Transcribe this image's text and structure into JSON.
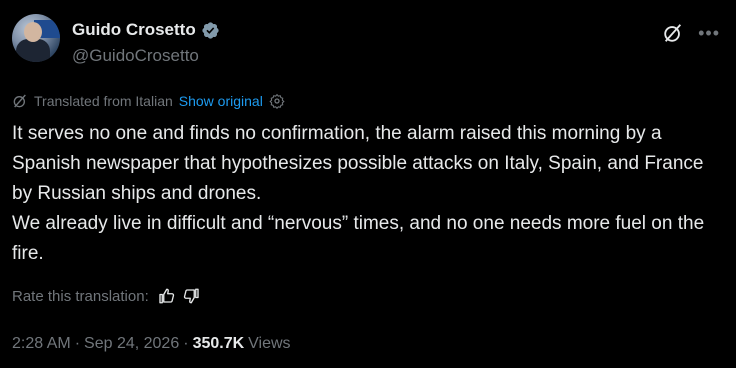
{
  "author": {
    "name": "Guido Crosetto",
    "handle": "@GuidoCrosetto"
  },
  "translation": {
    "label": "Translated from Italian",
    "show_original": "Show original"
  },
  "tweet": {
    "paragraph1": "It serves no one and finds no confirmation, the alarm raised this morning by a Spanish newspaper that hypothesizes possible attacks on Italy, Spain, and France by Russian ships and drones.",
    "paragraph2": "We already live in difficult and “nervous” times, and no one needs more fuel on the fire."
  },
  "rate": {
    "label": "Rate this translation:"
  },
  "meta": {
    "time": "2:28 AM",
    "sep1": "·",
    "date": "Sep 24, 2026",
    "sep2": "·",
    "views_count": "350.7K",
    "views_label": "Views"
  },
  "colors": {
    "background": "#000000",
    "text": "#e7e9ea",
    "muted": "#71767b",
    "link": "#1d9bf0",
    "verified": "#829aab"
  },
  "icons": [
    "verified-badge-icon",
    "grok-icon",
    "more-icon",
    "translate-icon",
    "settings-icon",
    "thumbs-up-icon",
    "thumbs-down-icon"
  ]
}
